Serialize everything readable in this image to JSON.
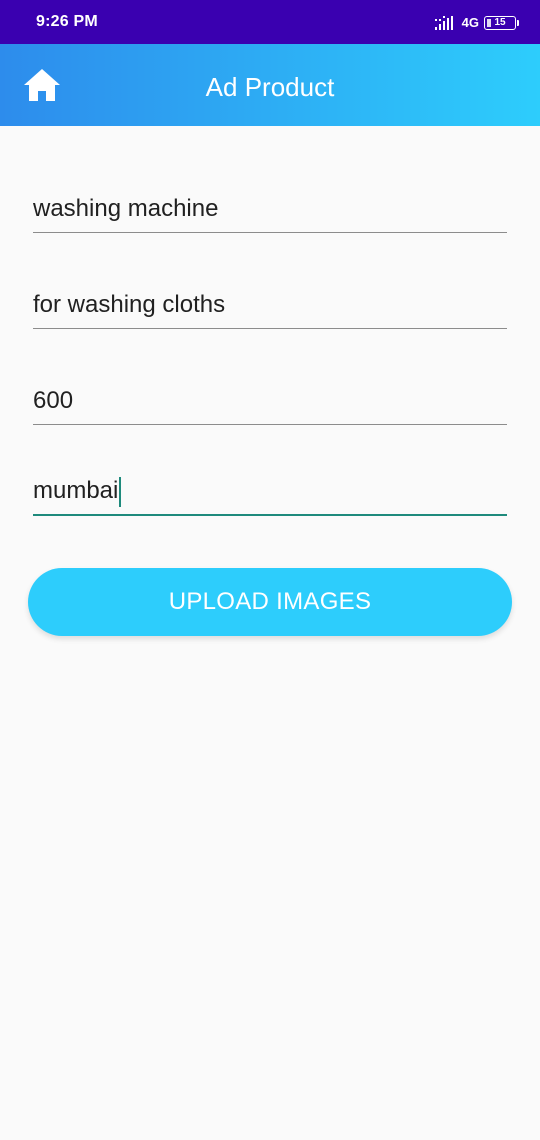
{
  "status_bar": {
    "time": "9:26 PM",
    "network": "4G",
    "battery_level": "15",
    "battery_fraction": 0.15
  },
  "app_bar": {
    "title": "Ad Product",
    "home_icon": "home-icon"
  },
  "form": {
    "fields": [
      {
        "value": "washing machine"
      },
      {
        "value": "for washing cloths"
      },
      {
        "value": "600"
      },
      {
        "value": "mumbai"
      }
    ],
    "upload_label": "UPLOAD IMAGES"
  },
  "colors": {
    "status_bar": "#3a00b0",
    "app_bar_start": "#2d8cec",
    "app_bar_end": "#2dcdfc",
    "button": "#2dcdfc",
    "focus_underline": "#1e8a7c",
    "background": "#fafafa"
  }
}
